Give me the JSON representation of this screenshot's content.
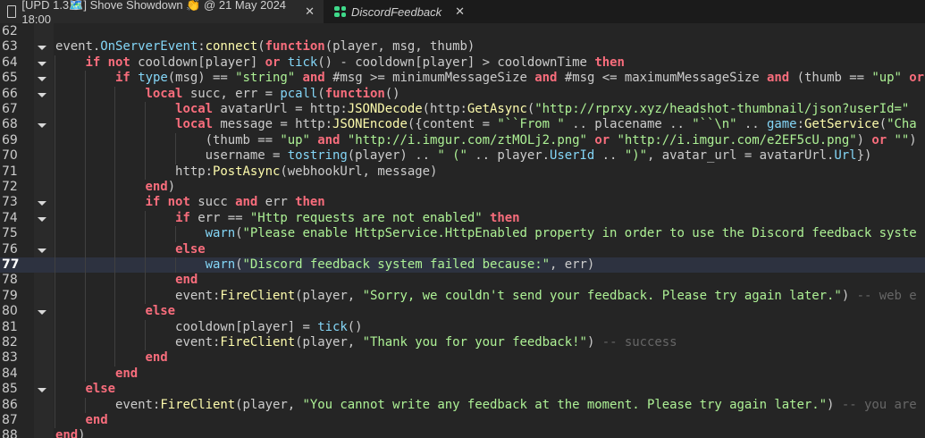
{
  "tabs": [
    {
      "label": "[UPD 1.3🗺️] Shove Showdown 👏 @ 21 May 2024 18:00",
      "icon": "document-icon",
      "close": "✕"
    },
    {
      "label": "DiscordFeedback",
      "icon": "script-icon",
      "close": "✕"
    }
  ],
  "editor": {
    "current_line": 77,
    "colors": {
      "keyword": "#f86d7c",
      "builtin": "#84d6f7",
      "method": "#fdfbac",
      "string": "#adf195",
      "comment": "#666666",
      "text": "#cccccc"
    },
    "lines": [
      {
        "n": "62",
        "fold": false,
        "tokens": []
      },
      {
        "n": "63",
        "fold": true,
        "tokens": [
          [
            "t",
            "event."
          ],
          [
            "b",
            "OnServerEvent"
          ],
          [
            "t",
            ":"
          ],
          [
            "f",
            "connect"
          ],
          [
            "t",
            "("
          ],
          [
            "k",
            "function"
          ],
          [
            "t",
            "(player, msg, thumb)"
          ]
        ]
      },
      {
        "n": "64",
        "fold": true,
        "tokens": [
          [
            "t",
            "    "
          ],
          [
            "k",
            "if not"
          ],
          [
            "t",
            " cooldown[player] "
          ],
          [
            "k",
            "or"
          ],
          [
            "t",
            " "
          ],
          [
            "b",
            "tick"
          ],
          [
            "t",
            "() - cooldown[player] > cooldownTime "
          ],
          [
            "k",
            "then"
          ]
        ]
      },
      {
        "n": "65",
        "fold": true,
        "tokens": [
          [
            "t",
            "        "
          ],
          [
            "k",
            "if"
          ],
          [
            "t",
            " "
          ],
          [
            "b",
            "type"
          ],
          [
            "t",
            "(msg) == "
          ],
          [
            "s",
            "\"string\""
          ],
          [
            "t",
            " "
          ],
          [
            "k",
            "and"
          ],
          [
            "t",
            " #msg >= minimumMessageSize "
          ],
          [
            "k",
            "and"
          ],
          [
            "t",
            " #msg <= maximumMessageSize "
          ],
          [
            "k",
            "and"
          ],
          [
            "t",
            " (thumb == "
          ],
          [
            "s",
            "\"up\""
          ],
          [
            "t",
            " "
          ],
          [
            "k",
            "or"
          ]
        ]
      },
      {
        "n": "66",
        "fold": true,
        "tokens": [
          [
            "t",
            "            "
          ],
          [
            "k",
            "local"
          ],
          [
            "t",
            " succ, err = "
          ],
          [
            "b",
            "pcall"
          ],
          [
            "t",
            "("
          ],
          [
            "k",
            "function"
          ],
          [
            "t",
            "()"
          ]
        ]
      },
      {
        "n": "67",
        "fold": false,
        "tokens": [
          [
            "t",
            "                "
          ],
          [
            "k",
            "local"
          ],
          [
            "t",
            " avatarUrl = http:"
          ],
          [
            "f",
            "JSONDecode"
          ],
          [
            "t",
            "(http:"
          ],
          [
            "f",
            "GetAsync"
          ],
          [
            "t",
            "("
          ],
          [
            "s",
            "\"http://rprxy.xyz/headshot-thumbnail/json?userId=\""
          ]
        ]
      },
      {
        "n": "68",
        "fold": true,
        "tokens": [
          [
            "t",
            "                "
          ],
          [
            "k",
            "local"
          ],
          [
            "t",
            " message = http:"
          ],
          [
            "f",
            "JSONEncode"
          ],
          [
            "t",
            "({content = "
          ],
          [
            "s",
            "\"``From \""
          ],
          [
            "t",
            " .. placename .. "
          ],
          [
            "s",
            "\"``\\n\""
          ],
          [
            "t",
            " .. "
          ],
          [
            "b",
            "game"
          ],
          [
            "t",
            ":"
          ],
          [
            "f",
            "GetService"
          ],
          [
            "t",
            "("
          ],
          [
            "s",
            "\"Cha"
          ]
        ]
      },
      {
        "n": "69",
        "fold": false,
        "tokens": [
          [
            "t",
            "                    (thumb == "
          ],
          [
            "s",
            "\"up\""
          ],
          [
            "t",
            " "
          ],
          [
            "k",
            "and"
          ],
          [
            "t",
            " "
          ],
          [
            "s",
            "\"http://i.imgur.com/ztMOLj2.png\""
          ],
          [
            "t",
            " "
          ],
          [
            "k",
            "or"
          ],
          [
            "t",
            " "
          ],
          [
            "s",
            "\"http://i.imgur.com/e2EF5cU.png\""
          ],
          [
            "t",
            ") "
          ],
          [
            "k",
            "or"
          ],
          [
            "t",
            " "
          ],
          [
            "s",
            "\"\""
          ],
          [
            "t",
            ")"
          ]
        ]
      },
      {
        "n": "70",
        "fold": false,
        "tokens": [
          [
            "t",
            "                    username = "
          ],
          [
            "b",
            "tostring"
          ],
          [
            "t",
            "(player) .. "
          ],
          [
            "s",
            "\" (\""
          ],
          [
            "t",
            " .. player."
          ],
          [
            "b",
            "UserId"
          ],
          [
            "t",
            " .. "
          ],
          [
            "s",
            "\")\""
          ],
          [
            "t",
            ", avatar_url = avatarUrl."
          ],
          [
            "b",
            "Url"
          ],
          [
            "t",
            "})"
          ]
        ]
      },
      {
        "n": "71",
        "fold": false,
        "tokens": [
          [
            "t",
            "                http:"
          ],
          [
            "f",
            "PostAsync"
          ],
          [
            "t",
            "(webhookUrl, message)"
          ]
        ]
      },
      {
        "n": "72",
        "fold": false,
        "tokens": [
          [
            "t",
            "            "
          ],
          [
            "k",
            "end"
          ],
          [
            "t",
            ")"
          ]
        ]
      },
      {
        "n": "73",
        "fold": true,
        "tokens": [
          [
            "t",
            "            "
          ],
          [
            "k",
            "if not"
          ],
          [
            "t",
            " succ "
          ],
          [
            "k",
            "and"
          ],
          [
            "t",
            " err "
          ],
          [
            "k",
            "then"
          ]
        ]
      },
      {
        "n": "74",
        "fold": true,
        "tokens": [
          [
            "t",
            "                "
          ],
          [
            "k",
            "if"
          ],
          [
            "t",
            " err == "
          ],
          [
            "s",
            "\"Http requests are not enabled\""
          ],
          [
            "t",
            " "
          ],
          [
            "k",
            "then"
          ]
        ]
      },
      {
        "n": "75",
        "fold": false,
        "tokens": [
          [
            "t",
            "                    "
          ],
          [
            "b",
            "warn"
          ],
          [
            "t",
            "("
          ],
          [
            "s",
            "\"Please enable HttpService.HttpEnabled property in order to use the Discord feedback syste"
          ]
        ]
      },
      {
        "n": "76",
        "fold": true,
        "tokens": [
          [
            "t",
            "                "
          ],
          [
            "k",
            "else"
          ]
        ]
      },
      {
        "n": "77",
        "fold": false,
        "tokens": [
          [
            "t",
            "                    "
          ],
          [
            "b",
            "warn"
          ],
          [
            "t",
            "("
          ],
          [
            "s",
            "\"Discord feedback system failed because:\""
          ],
          [
            "t",
            ", err)"
          ]
        ]
      },
      {
        "n": "78",
        "fold": false,
        "tokens": [
          [
            "t",
            "                "
          ],
          [
            "k",
            "end"
          ]
        ]
      },
      {
        "n": "79",
        "fold": false,
        "tokens": [
          [
            "t",
            "                event:"
          ],
          [
            "f",
            "FireClient"
          ],
          [
            "t",
            "(player, "
          ],
          [
            "s",
            "\"Sorry, we couldn't send your feedback. Please try again later.\""
          ],
          [
            "t",
            ") "
          ],
          [
            "c",
            "-- web e"
          ]
        ]
      },
      {
        "n": "80",
        "fold": true,
        "tokens": [
          [
            "t",
            "            "
          ],
          [
            "k",
            "else"
          ]
        ]
      },
      {
        "n": "81",
        "fold": false,
        "tokens": [
          [
            "t",
            "                cooldown[player] = "
          ],
          [
            "b",
            "tick"
          ],
          [
            "t",
            "()"
          ]
        ]
      },
      {
        "n": "82",
        "fold": false,
        "tokens": [
          [
            "t",
            "                event:"
          ],
          [
            "f",
            "FireClient"
          ],
          [
            "t",
            "(player, "
          ],
          [
            "s",
            "\"Thank you for your feedback!\""
          ],
          [
            "t",
            ") "
          ],
          [
            "c",
            "-- success"
          ]
        ]
      },
      {
        "n": "83",
        "fold": false,
        "tokens": [
          [
            "t",
            "            "
          ],
          [
            "k",
            "end"
          ]
        ]
      },
      {
        "n": "84",
        "fold": false,
        "tokens": [
          [
            "t",
            "        "
          ],
          [
            "k",
            "end"
          ]
        ]
      },
      {
        "n": "85",
        "fold": true,
        "tokens": [
          [
            "t",
            "    "
          ],
          [
            "k",
            "else"
          ]
        ]
      },
      {
        "n": "86",
        "fold": false,
        "tokens": [
          [
            "t",
            "        event:"
          ],
          [
            "f",
            "FireClient"
          ],
          [
            "t",
            "(player, "
          ],
          [
            "s",
            "\"You cannot write any feedback at the moment. Please try again later.\""
          ],
          [
            "t",
            ") "
          ],
          [
            "c",
            "-- you are"
          ]
        ]
      },
      {
        "n": "87",
        "fold": false,
        "tokens": [
          [
            "t",
            "    "
          ],
          [
            "k",
            "end"
          ]
        ]
      },
      {
        "n": "88",
        "fold": false,
        "tokens": [
          [
            "k",
            "end"
          ],
          [
            "t",
            ")"
          ]
        ]
      }
    ]
  }
}
